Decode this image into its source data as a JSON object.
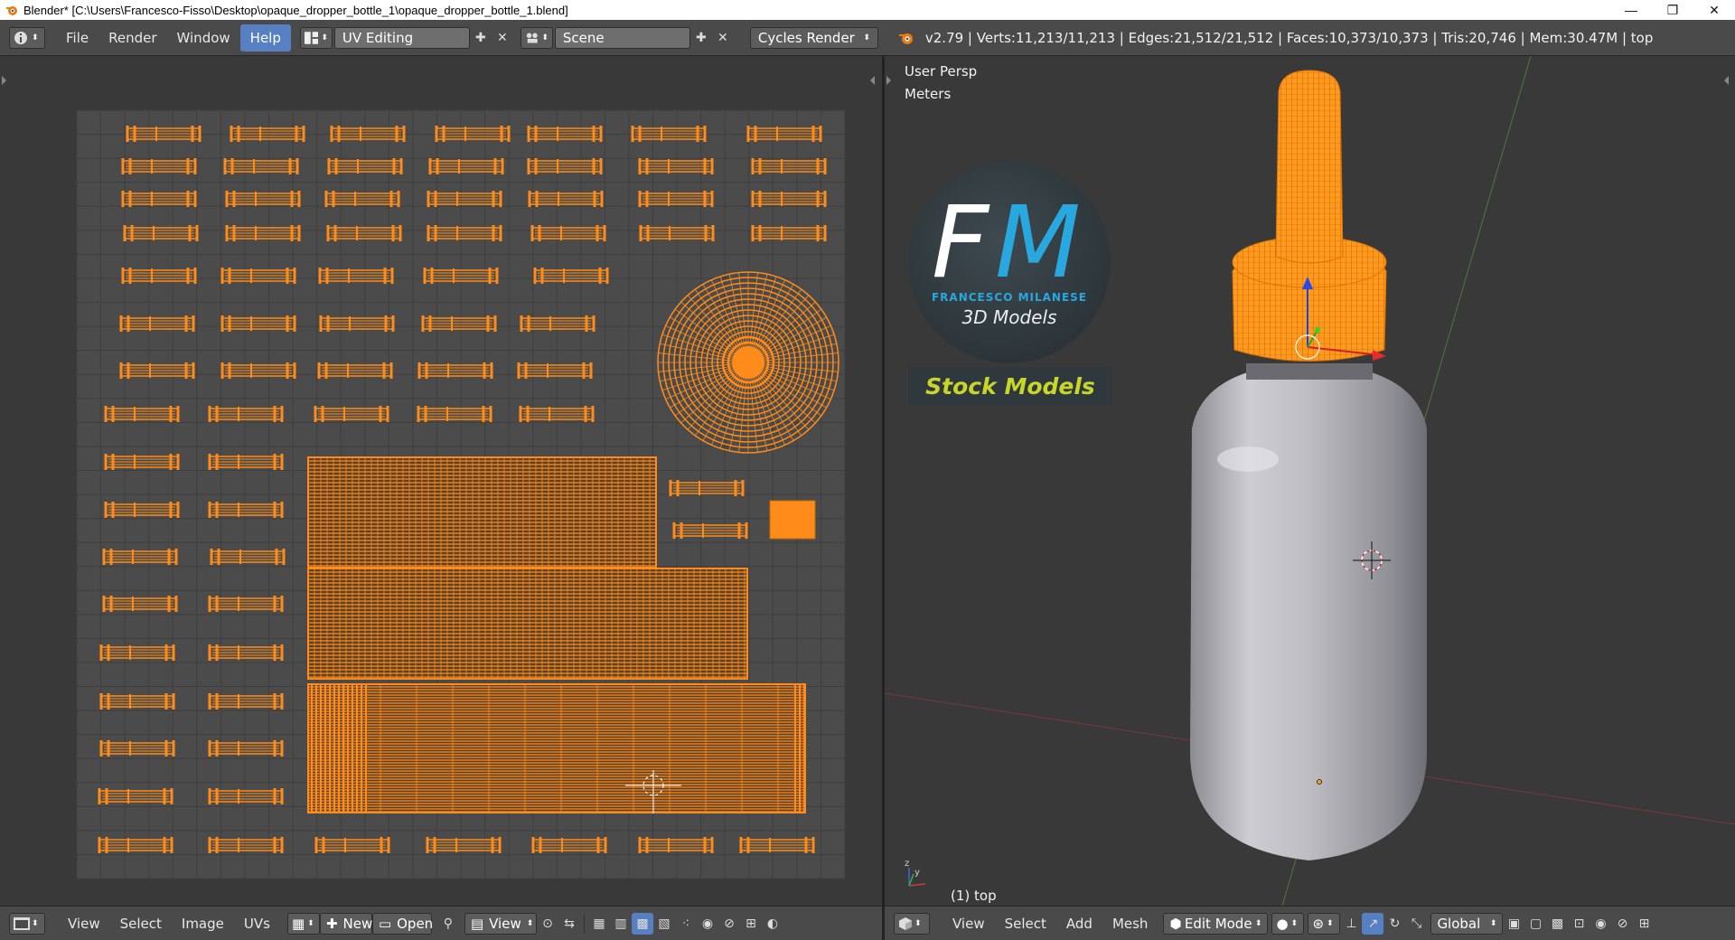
{
  "window": {
    "title": "Blender* [C:\\Users\\Francesco-Fisso\\Desktop\\opaque_dropper_bottle_1\\opaque_dropper_bottle_1.blend]",
    "min_icon": "minimize-icon",
    "max_icon": "restore-icon",
    "close_icon": "close-icon"
  },
  "header": {
    "menus": [
      "File",
      "Render",
      "Window",
      "Help"
    ],
    "active_menu": "Help",
    "layout": "UV Editing",
    "scene": "Scene",
    "engine": "Cycles Render",
    "stats": "v2.79 | Verts:11,213/11,213 | Edges:21,512/21,512 | Faces:10,373/10,373 | Tris:20,746 | Mem:30.47M | top"
  },
  "uv_editor": {
    "menus": [
      "View",
      "Select",
      "Image",
      "UVs"
    ],
    "new_label": "New",
    "open_label": "Open",
    "view_label": "View"
  },
  "viewport": {
    "view_name": "User Persp",
    "units": "Meters",
    "object_label": "(1) top",
    "menus": [
      "View",
      "Select",
      "Add",
      "Mesh"
    ],
    "mode": "Edit Mode",
    "orientation": "Global",
    "logo": {
      "brand_letters": "FM",
      "brand_name": "FRANCESCO MILANESE",
      "subtitle": "3D Models",
      "banner": "Stock Models"
    }
  },
  "colors": {
    "uv_orange": "#ff8c1a",
    "accent_blue": "#5680c2",
    "logo_cyan": "#29a8e0",
    "banner_yellow": "#c8d62a",
    "bottle_grey": "#b9b9bd"
  }
}
